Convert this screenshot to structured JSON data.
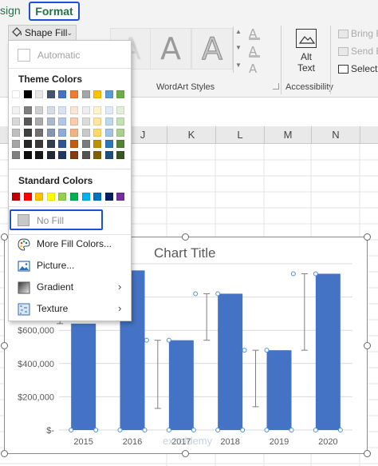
{
  "ribbon": {
    "tabs": {
      "design": "sign",
      "format": "Format"
    },
    "shape_fill_label": "Shape Fill",
    "wordart_glyph": "A",
    "wordart_styles_label": "WordArt Styles",
    "text_icons": [
      "A",
      "A",
      "A"
    ],
    "accessibility_label": "Accessibility",
    "alt_text_label": "Alt\nText",
    "arrange": [
      "Bring F",
      "Send B",
      "Select"
    ]
  },
  "columns": [
    "J",
    "K",
    "L",
    "M",
    "N"
  ],
  "menu": {
    "automatic_label": "Automatic",
    "theme_colors_label": "Theme Colors",
    "standard_colors_label": "Standard Colors",
    "no_fill_label": "No Fill",
    "items": [
      {
        "label": "More Fill Colors...",
        "icon": "palette-icon"
      },
      {
        "label": "Picture...",
        "icon": "picture-icon"
      },
      {
        "label": "Gradient",
        "icon": "gradient-icon",
        "submenu": true
      },
      {
        "label": "Texture",
        "icon": "texture-icon",
        "submenu": true
      }
    ],
    "theme_base": [
      "#ffffff",
      "#000000",
      "#e7e6e6",
      "#44546a",
      "#4472c4",
      "#ed7d31",
      "#a5a5a5",
      "#ffc000",
      "#5b9bd5",
      "#70ad47"
    ],
    "theme_shades": [
      [
        "#f2f2f2",
        "#7f7f7f",
        "#d0cece",
        "#d6dce4",
        "#d9e2f3",
        "#fbe5d5",
        "#ededed",
        "#fff2cc",
        "#deebf6",
        "#e2efd9"
      ],
      [
        "#d8d8d8",
        "#595959",
        "#aeabab",
        "#adb9ca",
        "#b4c6e7",
        "#f7cbac",
        "#dbdbdb",
        "#fee599",
        "#bdd7ee",
        "#c5e0b3"
      ],
      [
        "#bfbfbf",
        "#3f3f3f",
        "#757070",
        "#8496b0",
        "#8eaadb",
        "#f4b183",
        "#c9c9c9",
        "#ffd965",
        "#9dc3e6",
        "#a8d08d"
      ],
      [
        "#a5a5a5",
        "#262626",
        "#3a3838",
        "#323f4f",
        "#2f5496",
        "#c55a11",
        "#7b7b7b",
        "#bf9000",
        "#2e75b5",
        "#538135"
      ],
      [
        "#7f7f7f",
        "#0c0c0c",
        "#171616",
        "#222a35",
        "#1e3864",
        "#833c0b",
        "#525252",
        "#7f6000",
        "#1e4e79",
        "#375623"
      ]
    ],
    "standard": [
      "#c00000",
      "#ff0000",
      "#ffc000",
      "#ffff00",
      "#92d050",
      "#00b050",
      "#00b0f0",
      "#0070c0",
      "#002060",
      "#7030a0"
    ]
  },
  "chart_data": {
    "type": "bar",
    "title": "Chart Title",
    "categories": [
      "2015",
      "2016",
      "2017",
      "2018",
      "2019",
      "2020"
    ],
    "values": [
      640000,
      960000,
      540000,
      820000,
      480000,
      940000
    ],
    "error_low": [
      640000,
      null,
      130000,
      540000,
      140000,
      480000
    ],
    "error_high": [
      980000,
      null,
      540000,
      820000,
      480000,
      940000
    ],
    "y_ticks": [
      "$-",
      "$200,000",
      "$400,000",
      "$600,000",
      "$800,000"
    ],
    "ylim": [
      0,
      1000000
    ],
    "bar_color": "#4472c4",
    "grid": true
  },
  "watermark": "exceldemy"
}
